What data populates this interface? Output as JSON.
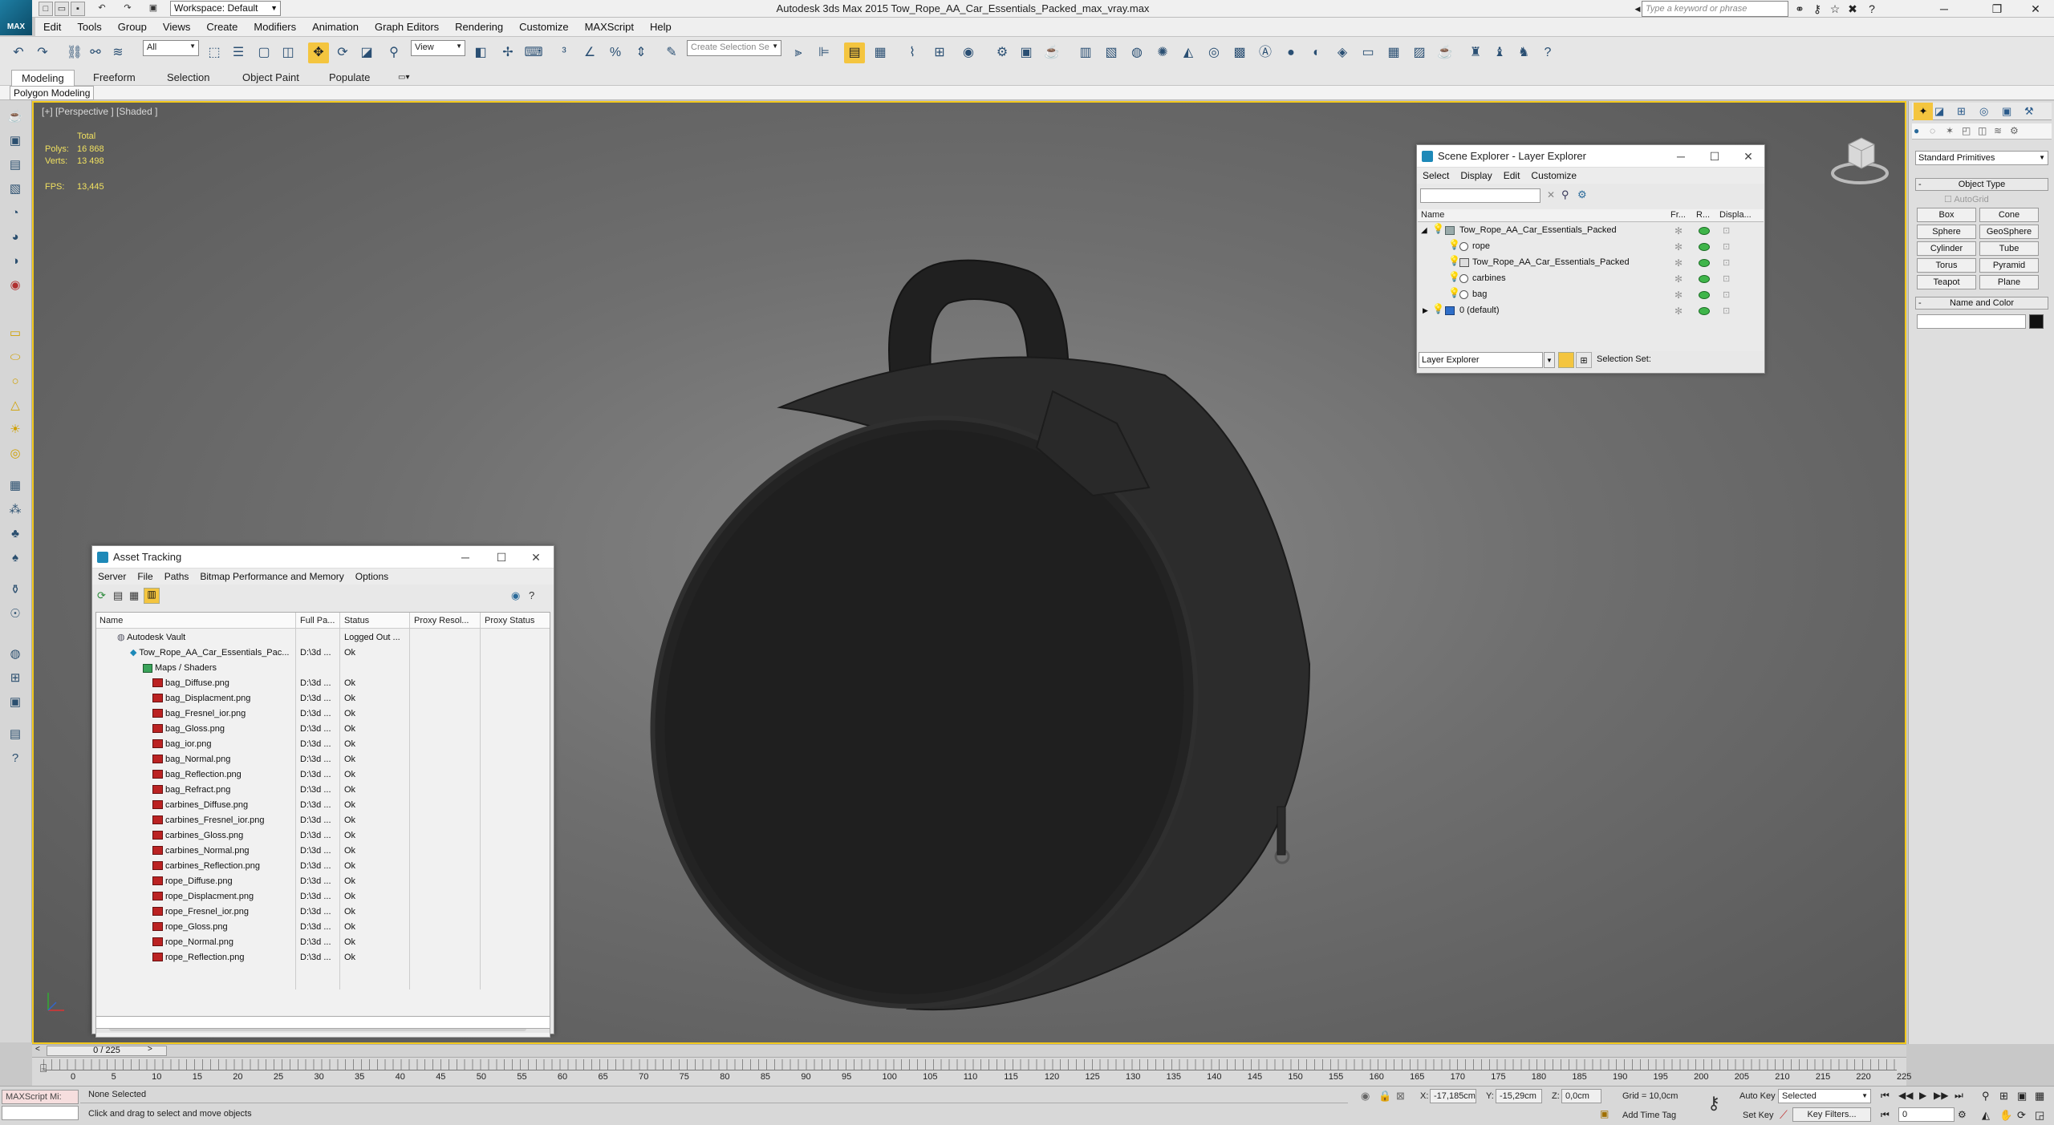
{
  "app": {
    "logo_label": "MAX",
    "window_title": "Autodesk 3ds Max 2015    Tow_Rope_AA_Car_Essentials_Packed_max_vray.max",
    "workspace": "Workspace: Default",
    "search_placeholder": "Type a keyword or phrase"
  },
  "menu": [
    "Edit",
    "Tools",
    "Group",
    "Views",
    "Create",
    "Modifiers",
    "Animation",
    "Graph Editors",
    "Rendering",
    "Customize",
    "MAXScript",
    "Help"
  ],
  "toolbar": {
    "filter_value": "All",
    "refcoord_value": "View",
    "selection_set_placeholder": "Create Selection Se"
  },
  "ribbon": {
    "tabs": [
      "Modeling",
      "Freeform",
      "Selection",
      "Object Paint",
      "Populate"
    ],
    "active_tab": "Modeling",
    "sub_label": "Polygon Modeling"
  },
  "viewport": {
    "label": "[+] [Perspective ] [Shaded ]",
    "stats_header": "Total",
    "polys_label": "Polys:",
    "polys_value": "16 868",
    "verts_label": "Verts:",
    "verts_value": "13 498",
    "fps_label": "FPS:",
    "fps_value": "13,445"
  },
  "scene_explorer": {
    "title": "Scene Explorer - Layer Explorer",
    "menu": [
      "Select",
      "Display",
      "Edit",
      "Customize"
    ],
    "columns": [
      "Name",
      "Fr...",
      "R...",
      "Displa..."
    ],
    "rows": [
      {
        "name": "Tow_Rope_AA_Car_Essentials_Packed",
        "level": 0,
        "expanded": true
      },
      {
        "name": "rope",
        "level": 1
      },
      {
        "name": "Tow_Rope_AA_Car_Essentials_Packed",
        "level": 1
      },
      {
        "name": "carbines",
        "level": 1
      },
      {
        "name": "bag",
        "level": 1
      },
      {
        "name": "0 (default)",
        "level": 0,
        "expanded": false
      }
    ],
    "explorer_select": "Layer Explorer",
    "selection_set_label": "Selection Set:"
  },
  "asset_tracking": {
    "title": "Asset Tracking",
    "menu": [
      "Server",
      "File",
      "Paths",
      "Bitmap Performance and Memory",
      "Options"
    ],
    "columns": [
      "Name",
      "Full Pa...",
      "Status",
      "Proxy Resol...",
      "Proxy Status"
    ],
    "vault": {
      "name": "Autodesk Vault",
      "status": "Logged Out ..."
    },
    "scene_file": {
      "name": "Tow_Rope_AA_Car_Essentials_Pac...",
      "path": "D:\\3d ...",
      "status": "Ok"
    },
    "maps_folder": "Maps / Shaders",
    "files": [
      {
        "name": "bag_Diffuse.png",
        "path": "D:\\3d ...",
        "status": "Ok"
      },
      {
        "name": "bag_Displacment.png",
        "path": "D:\\3d ...",
        "status": "Ok"
      },
      {
        "name": "bag_Fresnel_ior.png",
        "path": "D:\\3d ...",
        "status": "Ok"
      },
      {
        "name": "bag_Gloss.png",
        "path": "D:\\3d ...",
        "status": "Ok"
      },
      {
        "name": "bag_ior.png",
        "path": "D:\\3d ...",
        "status": "Ok"
      },
      {
        "name": "bag_Normal.png",
        "path": "D:\\3d ...",
        "status": "Ok"
      },
      {
        "name": "bag_Reflection.png",
        "path": "D:\\3d ...",
        "status": "Ok"
      },
      {
        "name": "bag_Refract.png",
        "path": "D:\\3d ...",
        "status": "Ok"
      },
      {
        "name": "carbines_Diffuse.png",
        "path": "D:\\3d ...",
        "status": "Ok"
      },
      {
        "name": "carbines_Fresnel_ior.png",
        "path": "D:\\3d ...",
        "status": "Ok"
      },
      {
        "name": "carbines_Gloss.png",
        "path": "D:\\3d ...",
        "status": "Ok"
      },
      {
        "name": "carbines_Normal.png",
        "path": "D:\\3d ...",
        "status": "Ok"
      },
      {
        "name": "carbines_Reflection.png",
        "path": "D:\\3d ...",
        "status": "Ok"
      },
      {
        "name": "rope_Diffuse.png",
        "path": "D:\\3d ...",
        "status": "Ok"
      },
      {
        "name": "rope_Displacment.png",
        "path": "D:\\3d ...",
        "status": "Ok"
      },
      {
        "name": "rope_Fresnel_ior.png",
        "path": "D:\\3d ...",
        "status": "Ok"
      },
      {
        "name": "rope_Gloss.png",
        "path": "D:\\3d ...",
        "status": "Ok"
      },
      {
        "name": "rope_Normal.png",
        "path": "D:\\3d ...",
        "status": "Ok"
      },
      {
        "name": "rope_Reflection.png",
        "path": "D:\\3d ...",
        "status": "Ok"
      }
    ]
  },
  "command_panel": {
    "category": "Standard Primitives",
    "object_type_label": "Object Type",
    "autogrid_label": "AutoGrid",
    "buttons": [
      "Box",
      "Cone",
      "Sphere",
      "GeoSphere",
      "Cylinder",
      "Tube",
      "Torus",
      "Pyramid",
      "Teapot",
      "Plane"
    ],
    "name_color_label": "Name and Color"
  },
  "timeline": {
    "frame_counter": "0 / 225",
    "ticks": [
      "0",
      "5",
      "10",
      "15",
      "20",
      "25",
      "30",
      "35",
      "40",
      "45",
      "50",
      "55",
      "60",
      "65",
      "70",
      "75",
      "80",
      "85",
      "90",
      "95",
      "100",
      "105",
      "110",
      "115",
      "120",
      "125",
      "130",
      "135",
      "140",
      "145",
      "150",
      "155",
      "160",
      "165",
      "170",
      "175",
      "180",
      "185",
      "190",
      "195",
      "200",
      "205",
      "210",
      "215",
      "220",
      "225"
    ]
  },
  "status": {
    "maxscript_label": "MAXScript Mi:",
    "selection": "None Selected",
    "prompt": "Click and drag to select and move objects",
    "x_label": "X:",
    "x_value": "-17,185cm",
    "y_label": "Y:",
    "y_value": "-15,29cm",
    "z_label": "Z:",
    "z_value": "0,0cm",
    "grid": "Grid = 10,0cm",
    "add_time_tag": "Add Time Tag",
    "auto_key": "Auto Key",
    "selected": "Selected",
    "set_key": "Set Key",
    "key_filters": "Key Filters...",
    "current_frame": "0"
  },
  "colors": {
    "accent_yellow": "#f2c81c",
    "bag_dark": "#262626"
  }
}
